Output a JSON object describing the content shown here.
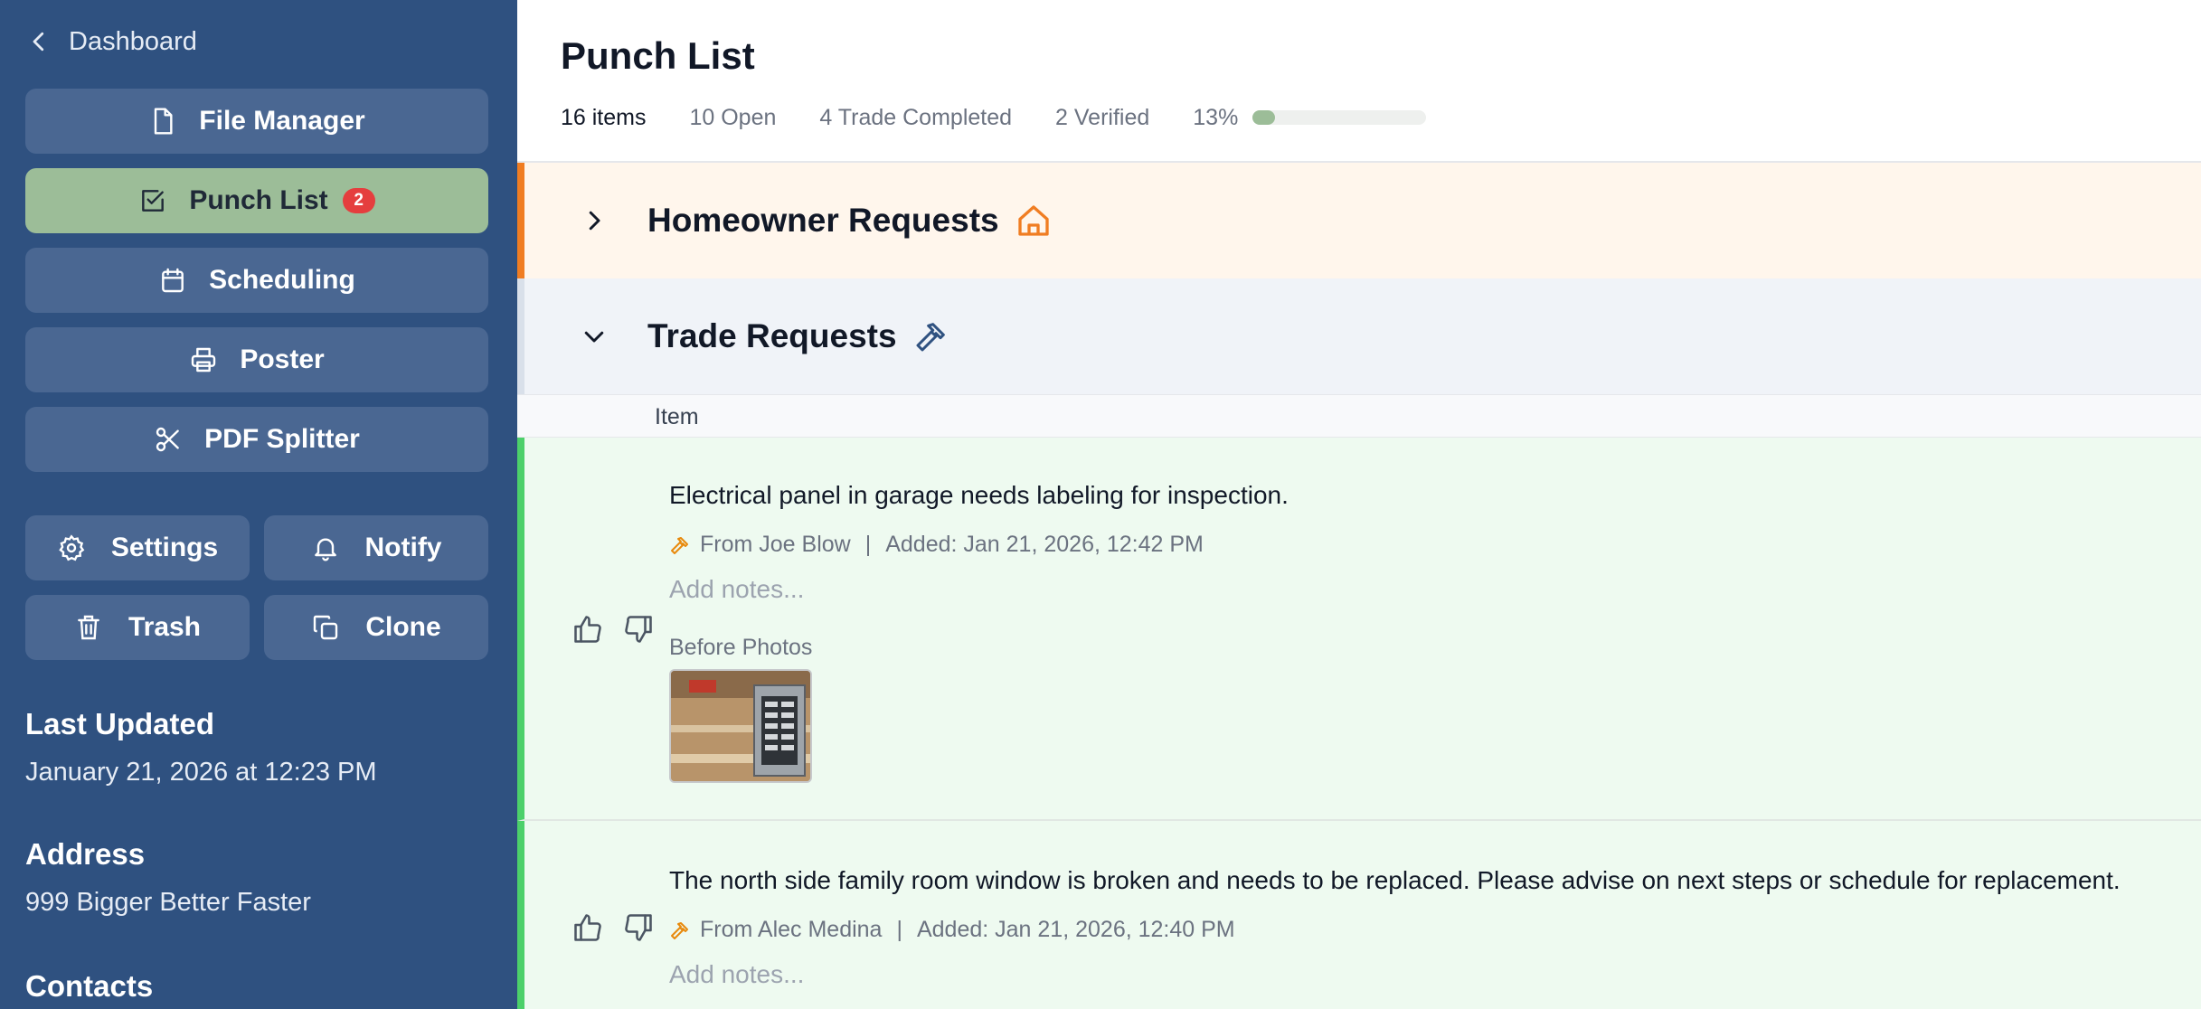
{
  "sidebar": {
    "back_label": "Dashboard",
    "nav": [
      {
        "label": "File Manager",
        "icon": "file-icon"
      },
      {
        "label": "Punch List",
        "icon": "checkbox-icon",
        "badge": "2",
        "active": true
      },
      {
        "label": "Scheduling",
        "icon": "calendar-icon"
      },
      {
        "label": "Poster",
        "icon": "printer-icon"
      },
      {
        "label": "PDF Splitter",
        "icon": "scissors-icon"
      }
    ],
    "actions": [
      {
        "label": "Settings",
        "icon": "gear-icon"
      },
      {
        "label": "Notify",
        "icon": "bell-icon"
      },
      {
        "label": "Trash",
        "icon": "trash-icon"
      },
      {
        "label": "Clone",
        "icon": "copy-icon"
      }
    ],
    "last_updated_heading": "Last Updated",
    "last_updated_value": "January 21, 2026 at 12:23 PM",
    "address_heading": "Address",
    "address_value": "999 Bigger Better Faster",
    "contacts_heading": "Contacts"
  },
  "main": {
    "title": "Punch List",
    "stats": {
      "total": "16 items",
      "open": "10 Open",
      "trade_completed": "4 Trade Completed",
      "verified": "2 Verified",
      "percent_label": "13%",
      "progress_fraction": 0.13
    },
    "sections": [
      {
        "title": "Homeowner Requests",
        "icon": "house-icon",
        "expanded": false
      },
      {
        "title": "Trade Requests",
        "icon": "hammer-icon",
        "expanded": true
      }
    ],
    "column_header": "Item",
    "items": [
      {
        "description": "Electrical panel in garage needs labeling for inspection.",
        "from": "From Joe Blow",
        "added": "Added: Jan 21, 2026, 12:42 PM",
        "notes_placeholder": "Add notes...",
        "photos_label": "Before Photos"
      },
      {
        "description": "The north side family room window is broken and needs to be replaced. Please advise on next steps or schedule for replacement.",
        "from": "From Alec Medina",
        "added": "Added: Jan 21, 2026, 12:40 PM",
        "notes_placeholder": "Add notes..."
      }
    ],
    "separator": "|"
  },
  "colors": {
    "sidebar_bg": "#2f5180",
    "nav_button": "#4a6792",
    "active_nav": "#9cbd98",
    "badge": "#e53e3e",
    "homeowner_accent": "#f07d22",
    "trade_accent": "#2f5180",
    "item_accent": "#4cd06a"
  }
}
